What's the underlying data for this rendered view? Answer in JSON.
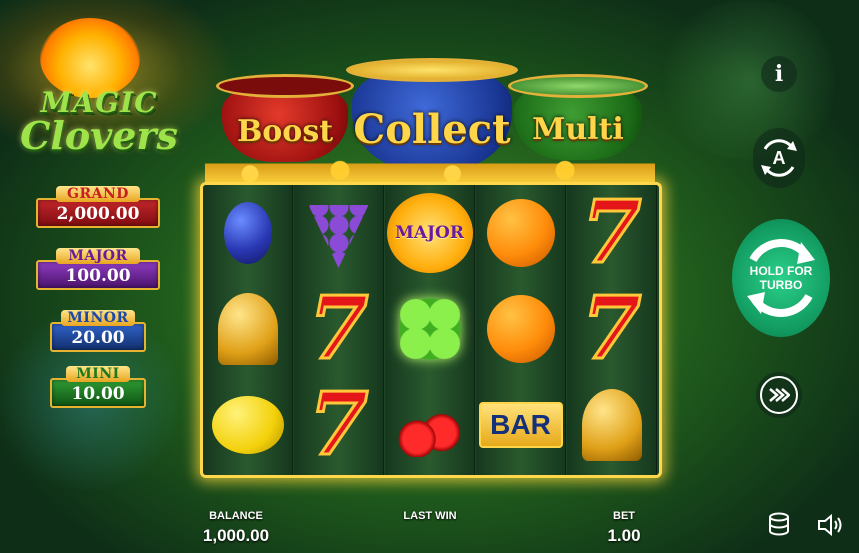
{
  "game": {
    "title_line1": "MAGIC",
    "title_line2": "Clovers"
  },
  "jackpots": [
    {
      "label": "GRAND",
      "value": "2,000.00",
      "color": "#c3262a"
    },
    {
      "label": "MAJOR",
      "value": "100.00",
      "color": "#8e3cc0"
    },
    {
      "label": "MINOR",
      "value": "20.00",
      "color": "#2f62c8"
    },
    {
      "label": "MINI",
      "value": "10.00",
      "color": "#2f9a34"
    }
  ],
  "pots": {
    "boost": "Boost",
    "collect": "Collect",
    "multi": "Multi"
  },
  "reels": [
    [
      "plum",
      "bell",
      "lemon"
    ],
    [
      "grapes",
      "seven",
      "seven"
    ],
    [
      "major-flower",
      "clover",
      "cherry"
    ],
    [
      "orange",
      "orange",
      "bar"
    ],
    [
      "seven",
      "seven",
      "bell"
    ]
  ],
  "symbols": {
    "major_text": "MAJOR",
    "bar_text": "BAR",
    "seven_text": "7"
  },
  "controls": {
    "info_label": "i",
    "auto_label": "A",
    "turbo_label": "HOLD FOR TURBO",
    "fast_forward_icon": "fast-forward-icon",
    "coins_icon": "coin-stack-icon",
    "sound_icon": "speaker-icon"
  },
  "footer": {
    "balance_label": "BALANCE",
    "balance_value": "1,000.00",
    "last_win_label": "LAST WIN",
    "last_win_value": "",
    "bet_label": "BET",
    "bet_value": "1.00"
  },
  "colors": {
    "reel_border": "#ffd74a",
    "turbo_green": "#11995f"
  }
}
